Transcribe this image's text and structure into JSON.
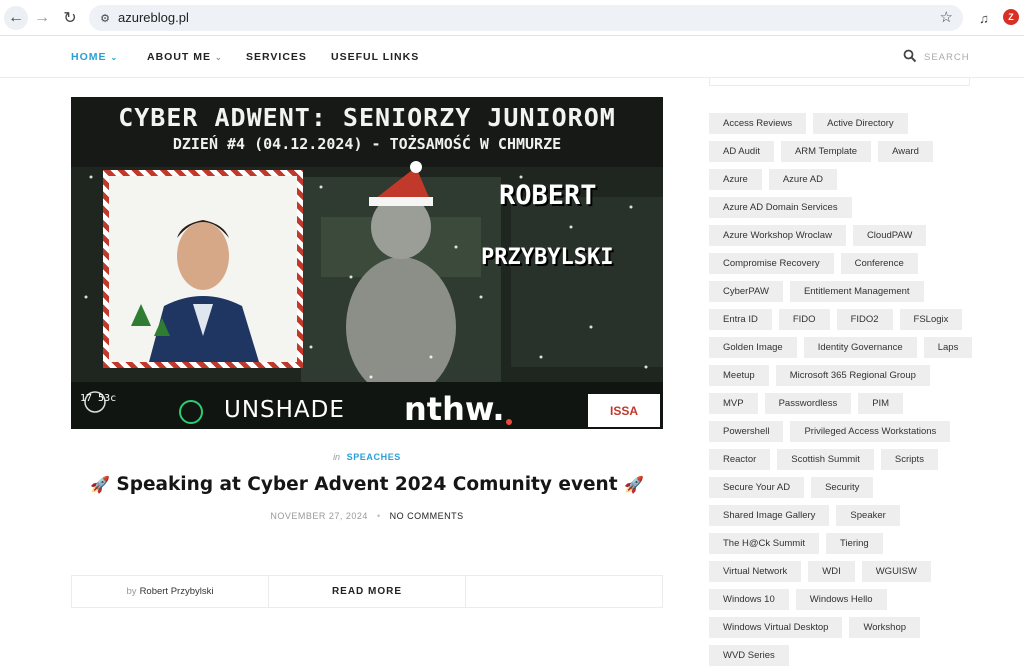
{
  "browser": {
    "url": "azureblog.pl",
    "profile_initial": "Z"
  },
  "nav": {
    "items": [
      {
        "label": "HOME",
        "has_caret": true,
        "active": true
      },
      {
        "label": "ABOUT ME",
        "has_caret": true,
        "active": false
      },
      {
        "label": "SERVICES",
        "has_caret": false,
        "active": false
      },
      {
        "label": "USEFUL LINKS",
        "has_caret": false,
        "active": false
      }
    ],
    "search_label": "SEARCH"
  },
  "hero": {
    "title": "CYBER ADWENT: SENIORZY JUNIOROM",
    "subtitle": "DZIEŃ #4 (04.12.2024) - TOŻSAMOŚĆ W CHMURZE",
    "name_first": "ROBERT",
    "name_last": "PRZYBYLSKI",
    "logo_left": "17 53c",
    "logo_unshade": "UNSHADE",
    "logo_nthw": "nthw.",
    "logo_issa": "ISSA"
  },
  "post": {
    "category_prefix": "in",
    "category": "SPEACHES",
    "title": "Speaking at Cyber Advent 2024 Comunity event",
    "title_emoji": "🚀",
    "date": "NOVEMBER 27, 2024",
    "separator": "•",
    "comments": "NO COMMENTS",
    "author_prefix": "by",
    "author": "Robert Przybylski",
    "read_more": "READ MORE"
  },
  "sidebar": {
    "tags": [
      "Access Reviews",
      "Active Directory",
      "AD Audit",
      "ARM Template",
      "Award",
      "Azure",
      "Azure AD",
      "Azure AD Domain Services",
      "Azure Workshop Wroclaw",
      "CloudPAW",
      "Compromise Recovery",
      "Conference",
      "CyberPAW",
      "Entitlement Management",
      "Entra ID",
      "FIDO",
      "FIDO2",
      "FSLogix",
      "Golden Image",
      "Identity Governance",
      "Laps",
      "Meetup",
      "Microsoft 365 Regional Group",
      "MVP",
      "Passwordless",
      "PIM",
      "Powershell",
      "Privileged Access Workstations",
      "Reactor",
      "Scottish Summit",
      "Scripts",
      "Secure Your AD",
      "Security",
      "Shared Image Gallery",
      "Speaker",
      "The H@Ck Summit",
      "Tiering",
      "Virtual Network",
      "WDI",
      "WGUISW",
      "Windows 10",
      "Windows Hello",
      "Windows Virtual Desktop",
      "Workshop",
      "WVD Series"
    ]
  }
}
